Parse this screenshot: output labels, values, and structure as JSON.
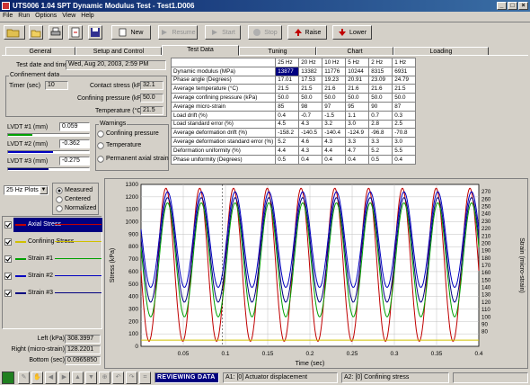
{
  "window": {
    "title": "UTS006 1.04 SPT Dynamic Modulus Test - Test1.D006"
  },
  "menu": [
    "File",
    "Run",
    "Options",
    "View",
    "Help"
  ],
  "toolbar": {
    "new": "New",
    "resume": "Resume",
    "start": "Start",
    "stop": "Stop",
    "raise": "Raise",
    "lower": "Lower"
  },
  "tabs": [
    "General",
    "Setup and Control",
    "Test Data",
    "Tuning",
    "Chart",
    "Loading"
  ],
  "active_tab": "Test Data",
  "test_info": {
    "date_label": "Test date and time",
    "date_value": "Wed, Aug 20, 2003, 2:59 PM",
    "group_label": "Confinement data",
    "timer_label": "Timer (sec)",
    "timer_value": "10",
    "contact_label": "Contact stress (kPa)",
    "contact_value": "32.1",
    "confining_label": "Confining pressure (kPa)",
    "confining_value": "50.0",
    "temp_label": "Temperature (°C)",
    "temp_value": "21.5"
  },
  "lvdt": [
    {
      "label": "LVDT #1 (mm)",
      "value": "0.059",
      "color": "#00a000",
      "fill": 0.3
    },
    {
      "label": "LVDT #2 (mm)",
      "value": "-0.362",
      "color": "#0000c0",
      "fill": 0.55
    },
    {
      "label": "LVDT #3 (mm)",
      "value": "-0.275",
      "color": "#000080",
      "fill": 0.5
    }
  ],
  "warnings": {
    "title": "Warnings",
    "items": [
      "Confining pressure",
      "Temperature",
      "Permanent axial strain"
    ]
  },
  "table": {
    "headers": [
      "25 Hz",
      "20 Hz",
      "10 Hz",
      "5 Hz",
      "2 Hz",
      "1 Hz"
    ],
    "rows": [
      {
        "label": "Dynamic modulus (MPa)",
        "values": [
          "13877",
          "13382",
          "11776",
          "10244",
          "8315",
          "6931"
        ]
      },
      {
        "label": "Phase angle (Degrees)",
        "values": [
          "17.01",
          "17.53",
          "19.23",
          "20.91",
          "23.09",
          "24.79"
        ]
      },
      {
        "label": "Average temperature  (°C)",
        "values": [
          "21.5",
          "21.5",
          "21.6",
          "21.6",
          "21.6",
          "21.5"
        ]
      },
      {
        "label": "Average confining pressure (kPa)",
        "values": [
          "50.0",
          "50.0",
          "50.0",
          "50.0",
          "50.0",
          "50.0"
        ]
      },
      {
        "label": "Average micro-strain",
        "values": [
          "85",
          "98",
          "97",
          "95",
          "90",
          "87"
        ]
      },
      {
        "label": "Load drift (%)",
        "values": [
          "0.4",
          "-0.7",
          "-1.5",
          "1.1",
          "0.7",
          "0.3"
        ]
      },
      {
        "label": "Load standard error (%)",
        "values": [
          "4.5",
          "4.3",
          "3.2",
          "3.0",
          "2.8",
          "2.5"
        ]
      },
      {
        "label": "Average deformation drift (%)",
        "values": [
          "-158.2",
          "-140.5",
          "-140.4",
          "-124.9",
          "-96.8",
          "-70.8"
        ]
      },
      {
        "label": "Average deformation standard error (%)",
        "values": [
          "5.2",
          "4.6",
          "4.3",
          "3.3",
          "3.3",
          "3.0"
        ]
      },
      {
        "label": "Deformation uniformity (%)",
        "values": [
          "4.4",
          "4.3",
          "4.4",
          "4.7",
          "5.2",
          "5.5"
        ]
      },
      {
        "label": "Phase uniformity (Degrees)",
        "values": [
          "0.5",
          "0.4",
          "0.4",
          "0.4",
          "0.5",
          "0.4"
        ]
      }
    ]
  },
  "plot_controls": {
    "select_value": "25 Hz Plots",
    "radios": [
      "Measured",
      "Centered",
      "Normalized"
    ],
    "selected": "Measured"
  },
  "legend": [
    {
      "label": "Axial Stress",
      "color": "#c00000",
      "selected": true
    },
    {
      "label": "Confining Stress",
      "color": "#d0c000",
      "selected": false
    },
    {
      "label": "Strain #1",
      "color": "#00a000",
      "selected": false
    },
    {
      "label": "Strain #2",
      "color": "#0000c0",
      "selected": false
    },
    {
      "label": "Strain #3",
      "color": "#000080",
      "selected": false
    }
  ],
  "readouts": [
    {
      "label": "Left (kPa)",
      "value": "308.3997"
    },
    {
      "label": "Right (micro-strain)",
      "value": "128.2201"
    },
    {
      "label": "Bottom (sec)",
      "value": "0.0965850"
    }
  ],
  "status": {
    "mode": "REVIEWING DATA",
    "a1": "A1: [0] Actuator displacement",
    "a2": "A2: [0] Confining stress"
  },
  "chart_data": {
    "type": "line",
    "xlabel": "Time (sec)",
    "ylabel": "Stress (kPa)",
    "y2label": "Strain (micro-strain)",
    "xlim": [
      0,
      0.4
    ],
    "ylim": [
      0,
      1300
    ],
    "y2lim": [
      60,
      280
    ],
    "xticks": [
      "0.05",
      "0.1",
      "0.15",
      "0.2",
      "0.25",
      "0.3",
      "0.35",
      "0.4"
    ],
    "yticks": [
      "0",
      "100",
      "200",
      "300",
      "400",
      "500",
      "600",
      "700",
      "800",
      "900",
      "1000",
      "1100",
      "1200",
      "1300"
    ],
    "y2ticks": [
      "80",
      "90",
      "100",
      "110",
      "120",
      "130",
      "140",
      "150",
      "160",
      "170",
      "180",
      "190",
      "200",
      "210",
      "220",
      "230",
      "240",
      "250",
      "260",
      "270"
    ],
    "frequency_hz": 25,
    "series": [
      {
        "name": "Axial Stress",
        "axis": "left",
        "color": "#c00000",
        "min": 40,
        "max": 1270,
        "phase": 0.0
      },
      {
        "name": "Confining Stress",
        "axis": "left",
        "color": "#d0c000",
        "min": 50,
        "max": 50,
        "phase": 0.0
      },
      {
        "name": "Strain #1",
        "axis": "right",
        "color": "#00a000",
        "min": 100,
        "max": 255,
        "phase": 0.0019
      },
      {
        "name": "Strain #2",
        "axis": "right",
        "color": "#0000c0",
        "min": 140,
        "max": 270,
        "phase": 0.0019
      },
      {
        "name": "Strain #3",
        "axis": "right",
        "color": "#000080",
        "min": 120,
        "max": 262,
        "phase": 0.0019
      }
    ]
  }
}
